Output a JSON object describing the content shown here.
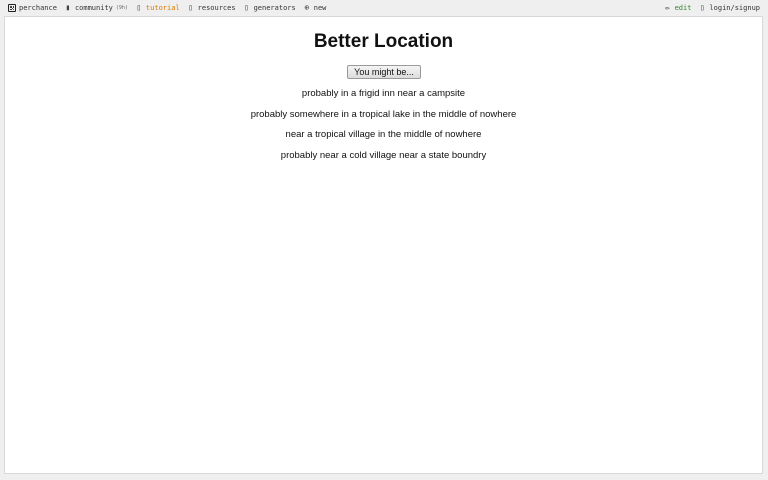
{
  "topbar": {
    "left": [
      {
        "id": "perchance",
        "label": "perchance",
        "icon": "die-icon"
      },
      {
        "id": "community",
        "label": "community",
        "sub": "(9h)",
        "icon": "chat-icon"
      },
      {
        "id": "tutorial",
        "label": "tutorial",
        "icon": "book-icon",
        "color": "#d97a00"
      },
      {
        "id": "resources",
        "label": "resources",
        "icon": "link-icon"
      },
      {
        "id": "generators",
        "label": "generators",
        "icon": "grid-icon"
      },
      {
        "id": "new",
        "label": "new",
        "icon": "plus-circle-icon"
      }
    ],
    "right": [
      {
        "id": "edit",
        "label": "edit",
        "icon": "pencil-icon",
        "color": "#2e8a2e"
      },
      {
        "id": "login",
        "label": "login/signup",
        "icon": "user-icon"
      }
    ]
  },
  "page": {
    "title": "Better Location",
    "button_label": "You might be...",
    "results": [
      "probably in a frigid inn near a campsite",
      "probably somewhere in a tropical lake in the middle of nowhere",
      "near a tropical village in the middle of nowhere",
      "probably near a cold village near a state boundry"
    ]
  }
}
